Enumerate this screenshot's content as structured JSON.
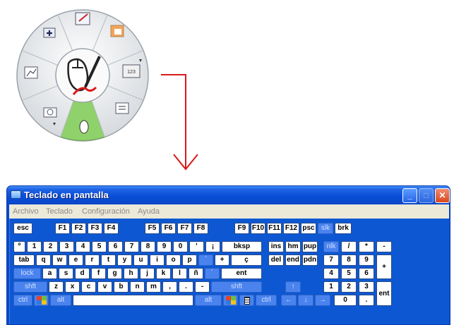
{
  "osk": {
    "title": "Teclado en pantalla",
    "menu": [
      "Archivo",
      "Teclado",
      "Configuración",
      "Ayuda"
    ],
    "controls": {
      "minimize": "_",
      "maximize": "□",
      "close": "✕"
    }
  },
  "keyboard": {
    "row_fn": [
      "esc",
      "F1",
      "F2",
      "F3",
      "F4",
      "F5",
      "F6",
      "F7",
      "F8",
      "F9",
      "F10",
      "F11",
      "F12",
      "psc",
      "slk",
      "brk"
    ],
    "row_num": [
      "º",
      "1",
      "2",
      "3",
      "4",
      "5",
      "6",
      "7",
      "8",
      "9",
      "0",
      "'",
      "¡",
      "bksp",
      "ins",
      "hm",
      "pup",
      "nlk",
      "/",
      "*",
      "-"
    ],
    "row_q": [
      "tab",
      "q",
      "w",
      "e",
      "r",
      "t",
      "y",
      "u",
      "i",
      "o",
      "p",
      "`",
      "+",
      "ç",
      "del",
      "end",
      "pdn",
      "7",
      "8",
      "9",
      "+"
    ],
    "row_a": [
      "lock",
      "a",
      "s",
      "d",
      "f",
      "g",
      "h",
      "j",
      "k",
      "l",
      "ñ",
      "´",
      "ent",
      "4",
      "5",
      "6"
    ],
    "row_z": [
      "shft",
      "z",
      "x",
      "c",
      "v",
      "b",
      "n",
      "m",
      ",",
      ".",
      "-",
      "shft",
      "↑",
      "1",
      "2",
      "3",
      "ent"
    ],
    "row_bottom": [
      "ctrl",
      "alt",
      "alt",
      "ctrl",
      "←",
      "↓",
      "→",
      "0",
      "."
    ]
  },
  "colors": {
    "window_blue": "#0a4ac9",
    "key_white": "#ffffff",
    "mod_key": "#4a83ee",
    "arrow_red": "#d9191a",
    "wheel_green": "#8fd16a"
  },
  "wheel": {
    "segments": [
      "plus-icon",
      "drawing-icon",
      "slides-icon",
      "keyboard-toggle-icon",
      "list-icon",
      "mouse-icon",
      "camera-icon",
      "chart-icon"
    ],
    "center": "mouse-pen-icon"
  }
}
